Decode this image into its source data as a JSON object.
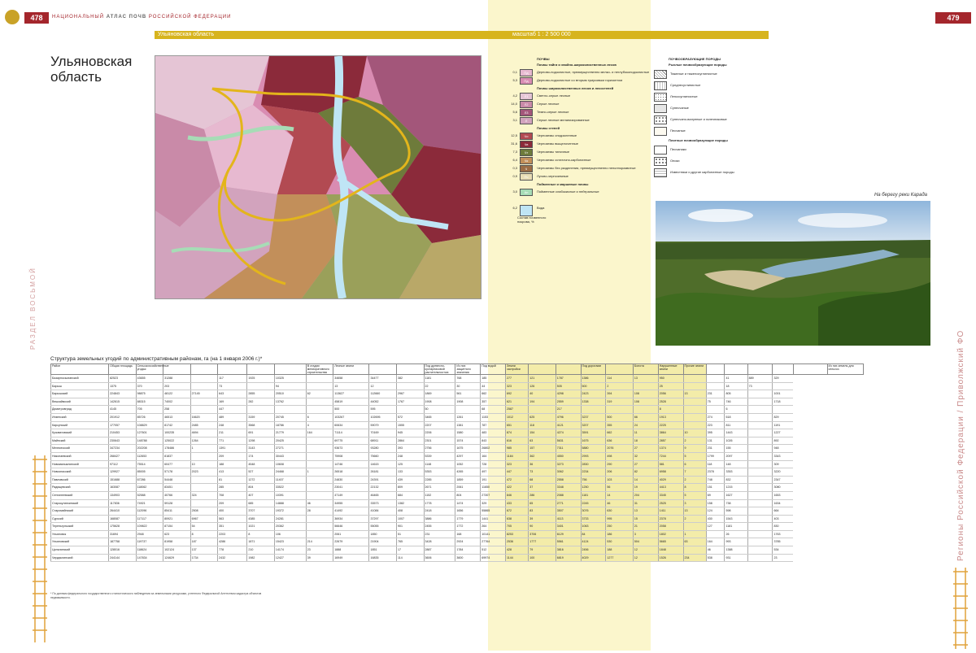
{
  "header": {
    "left_page_number": "478",
    "right_page_number": "479",
    "running_head_prefix": "НАЦИОНАЛЬНЫЙ",
    "running_head_bold": "АТЛАС ПОЧВ",
    "running_head_suffix": "РОССИЙСКОЙ ФЕДЕРАЦИИ"
  },
  "region_bar": {
    "name": "Ульяновская область",
    "scale": "масштаб 1 : 2 500 000"
  },
  "title": "Ульяновская область",
  "side_left": "РАЗДЕЛ ВОСЬМОЙ",
  "side_right": "Регионы Российской Федерации / Приволжский ФО",
  "legend_soils": {
    "heading": "ПОЧВЫ",
    "groups": [
      {
        "title": "Почвы тайги и хвойно-широколиственных лесов",
        "rows": [
          {
            "v": "0,1",
            "code": "Пд",
            "color": "#e7b9d0",
            "text": "Дерново-подзолистые, преимущественно мелко- и неглубокоподзолистые"
          },
          {
            "v": "5,3",
            "code": "Пд",
            "color": "#d98cb2",
            "text": "Дерново-подзолистые со вторым гумусовым горизонтом"
          }
        ]
      },
      {
        "title": "Почвы широколиственных лесов и лесостепей",
        "rows": [
          {
            "v": "4,2",
            "code": "Л1",
            "color": "#e5c5d5",
            "text": "Светло-серые лесные"
          },
          {
            "v": "14,0",
            "code": "Л2",
            "color": "#c98aa8",
            "text": "Серые лесные"
          },
          {
            "v": "5,6",
            "code": "Л3",
            "color": "#a3567a",
            "text": "Темно-серые лесные"
          },
          {
            "v": "3,1",
            "code": "Л",
            "color": "#d2a3bd",
            "text": "Серые лесные меланизированные"
          }
        ]
      },
      {
        "title": "Почвы степей",
        "rows": [
          {
            "v": "12,5",
            "code": "Чо",
            "color": "#b24a52",
            "text": "Черноземы оподзоленные"
          },
          {
            "v": "31,6",
            "code": "Чв",
            "color": "#8b2a3a",
            "text": "Черноземы выщелоченные"
          },
          {
            "v": "7,3",
            "code": "Чт",
            "color": "#6e7b3b",
            "text": "Черноземы типичные"
          },
          {
            "v": "6,4",
            "code": "Чк",
            "color": "#c28f5a",
            "text": "Черноземы остаточно-карбонатные"
          },
          {
            "v": "0,3",
            "code": "Ч",
            "color": "#9b6c45",
            "text": "Черноземы без разделения, преимущественно неполноразвитые"
          },
          {
            "v": "0,9",
            "code": "Пч",
            "color": "#e9ddb5",
            "text": "Лугово-черноземные"
          }
        ]
      },
      {
        "title": "Пойменные и маршевые почвы",
        "rows": [
          {
            "v": "3,0",
            "code": "Ап",
            "color": "#a7dcb6",
            "text": "Пойменные слабокислые и нейтральные"
          }
        ]
      }
    ],
    "water_value": "6,2",
    "water_label": "Вода",
    "water_note": "Состав почвенного покрова, %"
  },
  "legend_rocks": {
    "heading": "ПОЧВООБРАЗУЮЩИЕ ПОРОДЫ",
    "groups": [
      {
        "title": "Рыхлые почвообразующие породы",
        "rows": [
          "Тяжелые и тяжелосуглинистые",
          "Среднесуглинистые",
          "Легкосуглинистые",
          "Супесчаные",
          "Супесчано-валунные и галечниковые",
          "Песчаные"
        ]
      },
      {
        "title": "Плотные почвообразующие породы",
        "rows": [
          "Песчаники",
          "Опоки",
          "Известняки и другие карбонатные породы"
        ]
      }
    ]
  },
  "photo_caption": "На берегу реки Карада",
  "table": {
    "title": "Структура земельных угодий по административным районам, га (на 1 января 2006 г.)*",
    "headers": [
      "Район",
      "Общая площадь",
      "Сельскохозяйственные угодья",
      "",
      "",
      "",
      "",
      "",
      "В стадии мелиоративного строительства",
      "Лесные земли",
      "",
      "",
      "Под древесно-кустарниковой растительностью",
      "Из них защитного значения",
      "Под водой",
      "Земли застройки",
      "",
      "",
      "Под дорогами",
      "",
      "Болота",
      "Нарушенные земли",
      "Прочие земли",
      "",
      "",
      "",
      "",
      "",
      "Из них земель для сельхоз"
    ],
    "rows": [
      [
        "Базарносызганский",
        "82523",
        "43655",
        "31288",
        "",
        "117",
        "1925",
        "10325",
        "",
        "34658",
        "34477",
        "382",
        "1181",
        "768",
        "185",
        "277",
        "121",
        "1787",
        "1386",
        "114",
        "13",
        "950",
        "",
        "",
        "41",
        "889",
        "329"
      ],
      [
        "Барыш",
        "1375",
        "370",
        "203",
        "",
        "73",
        "",
        "94",
        "",
        "13",
        "12",
        "",
        "22",
        "30",
        "44",
        "323",
        "126",
        "505",
        "500",
        "2",
        "",
        "25",
        "",
        "",
        "18",
        "73",
        ""
      ],
      [
        "Барышский",
        "224843",
        "98875",
        "48122",
        "27145",
        "643",
        "2855",
        "20510",
        "62",
        "113627",
        "112660",
        "2967",
        "1869",
        "561",
        "662",
        "692",
        "40",
        "4298",
        "2423",
        "394",
        "108",
        "2056",
        "13",
        "231",
        "805",
        "",
        "1001"
      ],
      [
        "Вешкаймский",
        "142615",
        "88315",
        "74002",
        "",
        "169",
        "282",
        "13762",
        "",
        "45819",
        "44052",
        "1767",
        "1908",
        "1908",
        "357",
        "621",
        "194",
        "2559",
        "1338",
        "319",
        "108",
        "2528",
        "",
        "75",
        "746",
        "",
        "1718"
      ],
      [
        "Димитровград",
        "4145",
        "705",
        "258",
        "",
        "447",
        "",
        "",
        "",
        "500",
        "595",
        "",
        "50",
        "",
        "68",
        "2587",
        "",
        "217",
        "",
        "",
        "",
        "8",
        "",
        "",
        "6",
        "",
        ""
      ],
      [
        "Инзенский",
        "201912",
        "85726",
        "46513",
        "16620",
        "489",
        "3159",
        "20745",
        "6",
        "103267",
        "102695",
        "572",
        "3465",
        "1261",
        "1153",
        "1012",
        "625",
        "4796",
        "3237",
        "500",
        "66",
        "1913",
        "",
        "274",
        "618",
        "",
        "829"
      ],
      [
        "Карсунский",
        "177057",
        "108829",
        "81742",
        "2485",
        "248",
        "3568",
        "18786",
        "4",
        "60634",
        "59079",
        "1555",
        "2207",
        "1381",
        "787",
        "651",
        "118",
        "4121",
        "3207",
        "355",
        "24",
        "2225",
        "",
        "223",
        "811",
        "",
        "1191"
      ],
      [
        "Кузоватовский",
        "210453",
        "127601",
        "100235",
        "4694",
        "211",
        "691",
        "21779",
        "164",
        "71114",
        "70169",
        "945",
        "2206",
        "1580",
        "483",
        "874",
        "154",
        "4274",
        "3591",
        "662",
        "11",
        "3864",
        "10",
        "395",
        "1443",
        "",
        "1227"
      ],
      [
        "Майнский",
        "230643",
        "148788",
        "125022",
        "1264",
        "771",
        "1298",
        "20425",
        "",
        "69775",
        "68911",
        "2864",
        "2301",
        "1574",
        "843",
        "616",
        "63",
        "5631",
        "1675",
        "636",
        "18",
        "2857",
        "2",
        "131",
        "1026",
        "",
        "892"
      ],
      [
        "Мелекесский",
        "347234",
        "202208",
        "178486",
        "1",
        "1391",
        "3143",
        "27271",
        "",
        "93673",
        "93280",
        "393",
        "2756",
        "1675",
        "26802",
        "985",
        "157",
        "7311",
        "5880",
        "2076",
        "27",
        "1374",
        "9",
        "231",
        "155",
        "",
        "948"
      ],
      [
        "Николаевский",
        "268427",
        "112653",
        "81837",
        "",
        "209",
        "174",
        "30443",
        "",
        "75908",
        "75660",
        "248",
        "5339",
        "4297",
        "164",
        "1184",
        "362",
        "4550",
        "2993",
        "498",
        "32",
        "7244",
        "5",
        "1799",
        "2097",
        "",
        "3343"
      ],
      [
        "Новомалыклинский",
        "97112",
        "75514",
        "60477",
        "10",
        "188",
        "4548",
        "10608",
        "",
        "14746",
        "14615",
        "125",
        "1148",
        "1052",
        "728",
        "323",
        "36",
        "3273",
        "2830",
        "290",
        "27",
        "581",
        "6",
        "118",
        "148",
        "",
        "309"
      ],
      [
        "Новоспасский",
        "129927",
        "85005",
        "57178",
        "2023",
        "413",
        "527",
        "24468",
        "1",
        "26518",
        "26181",
        "133",
        "5353",
        "4265",
        "497",
        "447",
        "73",
        "3062",
        "2234",
        "206",
        "82",
        "6958",
        "7",
        "2378",
        "3353",
        "",
        "3220"
      ],
      [
        "Павловский",
        "151688",
        "67286",
        "54448",
        "",
        "81",
        "1272",
        "11407",
        "",
        "24830",
        "24391",
        "439",
        "2285",
        "1859",
        "191",
        "472",
        "68",
        "2558",
        "756",
        "103",
        "14",
        "4029",
        "2",
        "748",
        "832",
        "",
        "2347"
      ],
      [
        "Радищевский",
        "163087",
        "118062",
        "83451",
        "",
        "285",
        "804",
        "33522",
        "",
        "23041",
        "22132",
        "809",
        "2671",
        "2061",
        "11650",
        "422",
        "37",
        "3348",
        "1250",
        "56",
        "19",
        "4413",
        "8",
        "151",
        "1215",
        "",
        "3080"
      ],
      [
        "Сенгилеевский",
        "134903",
        "52588",
        "40766",
        "324",
        "708",
        "407",
        "10391",
        "",
        "47149",
        "46465",
        "684",
        "1152",
        "804",
        "27307",
        "846",
        "286",
        "2088",
        "1181",
        "14",
        "204",
        "3345",
        "5",
        "69",
        "1627",
        "",
        "1653"
      ],
      [
        "Старокулаткинский",
        "117836",
        "74921",
        "59128",
        "",
        "209",
        "685",
        "14888",
        "46",
        "34955",
        "33573",
        "1382",
        "1778",
        "1474",
        "329",
        "433",
        "65",
        "2771",
        "2245",
        "46",
        "31",
        "2525",
        "3",
        "158",
        "738",
        "",
        "1634"
      ],
      [
        "Старомайнский",
        "264410",
        "112096",
        "85411",
        "2508",
        "400",
        "3707",
        "19372",
        "28",
        "41492",
        "41084",
        "408",
        "2418",
        "1656",
        "55865",
        "672",
        "83",
        "3507",
        "3076",
        "630",
        "13",
        "1411",
        "13",
        "124",
        "598",
        "",
        "664"
      ],
      [
        "Сурский",
        "168087",
        "117117",
        "80921",
        "6967",
        "563",
        "4385",
        "24281",
        "",
        "36934",
        "37297",
        "1007",
        "3886",
        "1779",
        "1441",
        "638",
        "39",
        "4113",
        "3733",
        "995",
        "15",
        "2378",
        "2",
        "430",
        "1543",
        "",
        "403"
      ],
      [
        "Тереньгульский",
        "175628",
        "109822",
        "87154",
        "54",
        "351",
        "1021",
        "20362",
        "",
        "56646",
        "55055",
        "901",
        "2455",
        "1772",
        "264",
        "705",
        "90",
        "3401",
        "1063",
        "250",
        "21",
        "2058",
        "",
        "127",
        "1181",
        "",
        "830"
      ],
      [
        "Ульяновск",
        "31694",
        "2948",
        "623",
        "8",
        "2203",
        "8",
        "106",
        "",
        "2061",
        "1850",
        "51",
        "231",
        "168",
        "10141",
        "8253",
        "3706",
        "6129",
        "84",
        "186",
        "3",
        "1802",
        "1",
        "",
        "26",
        "",
        "1763"
      ],
      [
        "Ульяновский",
        "187758",
        "119737",
        "81958",
        "187",
        "4286",
        "1871",
        "15423",
        "214",
        "22679",
        "21904",
        "765",
        "3428",
        "2924",
        "27764",
        "2536",
        "1777",
        "5561",
        "4124",
        "530",
        "504",
        "5665",
        "63",
        "164",
        "993",
        "",
        "3785"
      ],
      [
        "Цильнинский",
        "128016",
        "118624",
        "102124",
        "137",
        "778",
        "210",
        "14174",
        "23",
        "1888",
        "1851",
        "17",
        "2887",
        "1784",
        "512",
        "428",
        "79",
        "3816",
        "2456",
        "188",
        "12",
        "1848",
        "",
        "46",
        "1388",
        "",
        "534"
      ],
      [
        "Чердаклинский",
        "244144",
        "147834",
        "124629",
        "1734",
        "2432",
        "1982",
        "12427",
        "39",
        "16949",
        "16835",
        "114",
        "3606",
        "3600",
        "69974",
        "1144",
        "100",
        "6819",
        "4029",
        "1277",
        "12",
        "1526",
        "234",
        "538",
        "931",
        "",
        "23"
      ]
    ]
  },
  "footnote": "* По данным федерального государственного статистического наблюдения за земельными ресурсами, учтенного Федеральной Агентством кадастра объектов недвижимости."
}
